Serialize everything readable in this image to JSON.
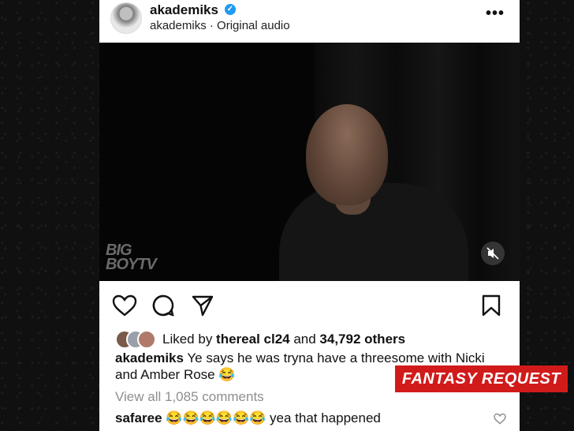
{
  "post": {
    "username": "akademiks",
    "subtitle": "akademiks · Original audio",
    "more_label": "•••",
    "verified_mark": "✓"
  },
  "video": {
    "watermark_line1": "BIG",
    "watermark_line2": "BOYTV",
    "muted": true
  },
  "likes": {
    "prefix": "Liked by ",
    "user": "thereal cl24",
    "mid": " and ",
    "count": "34,792 others"
  },
  "caption": {
    "username": "akademiks",
    "text": " Ye says he was tryna have a threesome with Nicki and Amber Rose 😂"
  },
  "comments": {
    "view_all": "View all 1,085 comments",
    "first": {
      "username": "safaree",
      "text": " 😂😂😂😂😂😂 yea that happened"
    }
  },
  "banner": {
    "label": "FANTASY REQUEST"
  },
  "colors": {
    "banner": "#d11b1b",
    "verified": "#1d9bf0",
    "muted_text": "#8e8e8e"
  },
  "icons": [
    "heart-icon",
    "comment-icon",
    "share-icon",
    "bookmark-icon",
    "mute-icon",
    "more-icon",
    "verified-icon"
  ]
}
